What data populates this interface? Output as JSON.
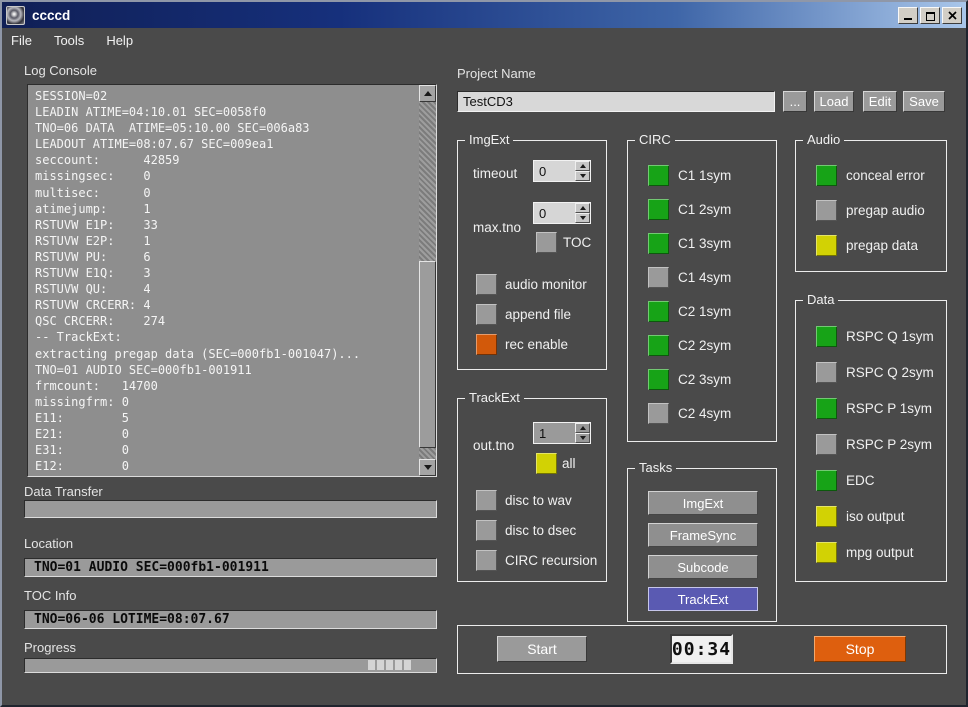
{
  "window": {
    "title": "ccccd"
  },
  "menu": {
    "items": [
      "File",
      "Tools",
      "Help"
    ]
  },
  "left": {
    "log_label": "Log Console",
    "log_text": "SESSION=02\nLEADIN ATIME=04:10.01 SEC=0058f0\nTNO=06 DATA  ATIME=05:10.00 SEC=006a83\nLEADOUT ATIME=08:07.67 SEC=009ea1\nseccount:      42859\nmissingsec:    0\nmultisec:      0\natimejump:     1\nRSTUVW E1P:    33\nRSTUVW E2P:    1\nRSTUVW PU:     6\nRSTUVW E1Q:    3\nRSTUVW QU:     4\nRSTUVW CRCERR: 4\nQSC CRCERR:    274\n-- TrackExt:\nextracting pregap data (SEC=000fb1-001047)...\nTNO=01 AUDIO SEC=000fb1-001911\nfrmcount:   14700\nmissingfrm: 0\nE11:        5\nE21:        0\nE31:        0\nE12:        0",
    "data_transfer_label": "Data Transfer",
    "location_label": "Location",
    "location_value": "TNO=01 AUDIO SEC=000fb1-001911",
    "toc_label": "TOC Info",
    "toc_value": "TNO=06-06  LOTIME=08:07.67",
    "progress_label": "Progress"
  },
  "project": {
    "label": "Project Name",
    "value": "TestCD3",
    "buttons": {
      "browse": "...",
      "load": "Load",
      "edit": "Edit",
      "save": "Save"
    }
  },
  "imgext": {
    "title": "ImgExt",
    "timeout": {
      "label": "timeout",
      "value": "0"
    },
    "max_tno": {
      "label": "max.tno",
      "value": "0"
    },
    "checks": [
      {
        "label": "TOC",
        "state": "gray"
      },
      {
        "label": "audio monitor",
        "state": "gray"
      },
      {
        "label": "append file",
        "state": "gray"
      },
      {
        "label": "rec enable",
        "state": "orange"
      }
    ]
  },
  "circ": {
    "title": "CIRC",
    "items": [
      {
        "label": "C1 1sym",
        "state": "green"
      },
      {
        "label": "C1 2sym",
        "state": "green"
      },
      {
        "label": "C1 3sym",
        "state": "green"
      },
      {
        "label": "C1 4sym",
        "state": "gray"
      },
      {
        "label": "C2 1sym",
        "state": "green"
      },
      {
        "label": "C2 2sym",
        "state": "green"
      },
      {
        "label": "C2 3sym",
        "state": "green"
      },
      {
        "label": "C2 4sym",
        "state": "gray"
      }
    ]
  },
  "audio": {
    "title": "Audio",
    "items": [
      {
        "label": "conceal error",
        "state": "green"
      },
      {
        "label": "pregap audio",
        "state": "gray"
      },
      {
        "label": "pregap data",
        "state": "yellow"
      }
    ]
  },
  "data_group": {
    "title": "Data",
    "items": [
      {
        "label": "RSPC Q 1sym",
        "state": "green"
      },
      {
        "label": "RSPC Q 2sym",
        "state": "gray"
      },
      {
        "label": "RSPC P 1sym",
        "state": "green"
      },
      {
        "label": "RSPC P 2sym",
        "state": "gray"
      },
      {
        "label": "EDC",
        "state": "green"
      },
      {
        "label": "iso output",
        "state": "yellow"
      },
      {
        "label": "mpg output",
        "state": "yellow"
      }
    ]
  },
  "trackext": {
    "title": "TrackExt",
    "out_tno": {
      "label": "out.tno",
      "value": "1"
    },
    "checks": [
      {
        "label": "all",
        "state": "yellow"
      },
      {
        "label": "disc to wav",
        "state": "gray"
      },
      {
        "label": "disc to dsec",
        "state": "gray"
      },
      {
        "label": "CIRC recursion",
        "state": "gray"
      }
    ]
  },
  "tasks": {
    "title": "Tasks",
    "buttons": [
      {
        "label": "ImgExt",
        "active": "false"
      },
      {
        "label": "FrameSync",
        "active": "false"
      },
      {
        "label": "Subcode",
        "active": "false"
      },
      {
        "label": "TrackExt",
        "active": "true"
      }
    ]
  },
  "runbar": {
    "start": "Start",
    "timer": "00:34",
    "stop": "Stop"
  },
  "colors": {
    "background": "#4a4a4a",
    "indicator_green": "#17a317",
    "indicator_yellow": "#d2d204",
    "indicator_orange": "#d2590a",
    "indicator_off_gray": "#9a9a9a",
    "task_active_blue": "#5a5ab2",
    "stop_orange": "#de5f0e",
    "titlebar_dark": "#101f55",
    "titlebar_light": "#a9c6ea"
  }
}
